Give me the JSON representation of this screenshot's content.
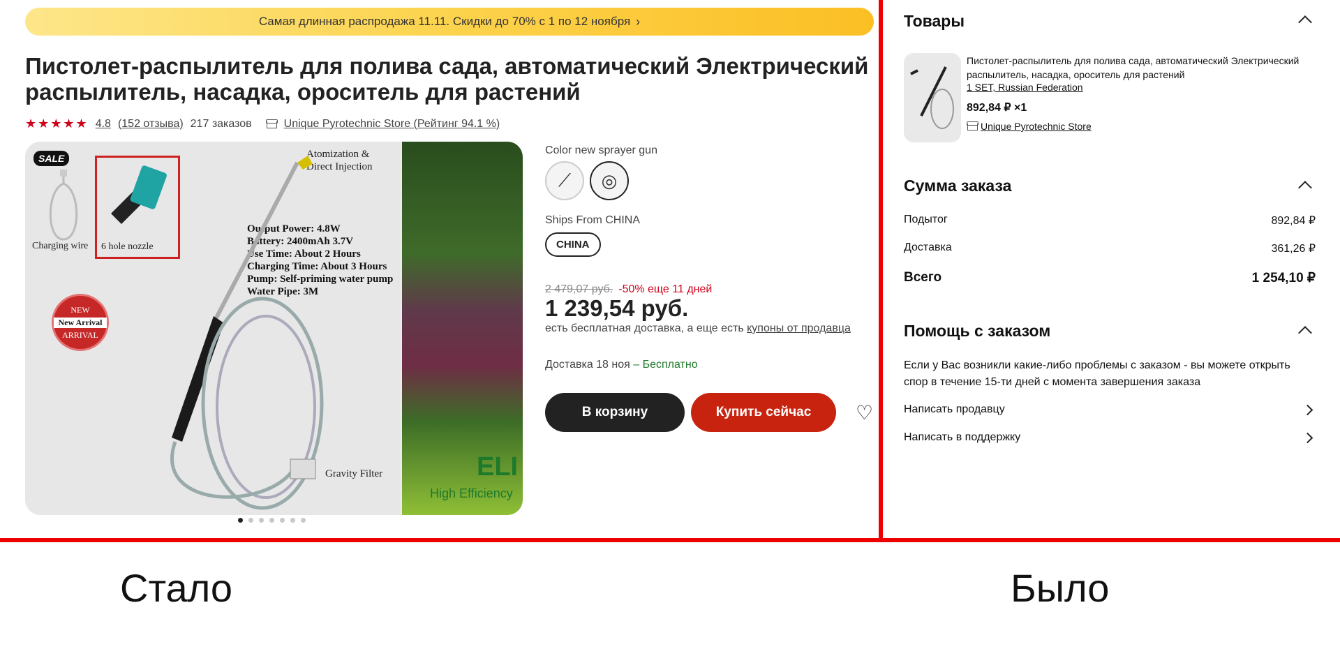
{
  "banner": {
    "text": "Самая длинная распродажа 11.11. Скидки до 70% с 1 по 12 ноября"
  },
  "product": {
    "title": "Пистолет-распылитель для полива сада, автоматический Электрический распылитель, насадка, ороситель для растений",
    "rating": "4.8",
    "reviews": "(152 отзыва)",
    "orders": "217 заказов",
    "store": "Unique Pyrotechnic Store (Рейтинг 94.1 %)"
  },
  "gallery": {
    "sale": "SALE",
    "charging_wire": "Charging wire",
    "nozzle": "6 hole nozzle",
    "atomization": "Atomization &",
    "direct_injection": "Direct Injection",
    "specs": [
      "Output Power: 4.8W",
      "Battery: 2400mAh 3.7V",
      "Use Time: About 2 Hours",
      "Charging Time: About 3 Hours",
      "Pump: Self-priming water pump",
      "Water Pipe: 3M"
    ],
    "new_top": "NEW",
    "new_mid": "New Arrival",
    "new_bottom": "ARRIVAL",
    "gravity_filter": "Gravity Filter",
    "elite": "ELI",
    "high_eff": "High Efficiency",
    "dots": 7,
    "active_dot": 0
  },
  "options": {
    "color_label": "Color new sprayer gun",
    "ships_label": "Ships From CHINA",
    "ships_value": "CHINA"
  },
  "pricing": {
    "old_price": "2 479,07 руб.",
    "discount": "-50% еще 11 дней",
    "price": "1 239,54 руб.",
    "free_note": "есть бесплатная доставка, а еще есть",
    "coupon_link": "купоны от продавца",
    "delivery": "Доставка 18 ноя",
    "delivery_free": "– Бесплатно"
  },
  "actions": {
    "cart": "В корзину",
    "buy": "Купить сейчас"
  },
  "summary": {
    "goods_header": "Товары",
    "item_title": "Пистолет-распылитель для полива сада, автоматический Электрический распылитель, насадка, ороситель для растений",
    "item_variant": "1 SET, Russian Federation",
    "item_price": "892,84 ₽ ×1",
    "item_store": "Unique Pyrotechnic Store",
    "order_header": "Сумма заказа",
    "subtotal_label": "Подытог",
    "subtotal_value": "892,84 ₽",
    "shipping_label": "Доставка",
    "shipping_value": "361,26 ₽",
    "total_label": "Всего",
    "total_value": "1 254,10 ₽",
    "help_header": "Помощь с заказом",
    "help_text": "Если у Вас возникли какие-либо проблемы с заказом - вы можете открыть спор в течение 15-ти дней с момента завершения заказа",
    "contact_seller": "Написать продавцу",
    "contact_support": "Написать в поддержку"
  },
  "captions": {
    "now": "Стало",
    "before": "Было"
  },
  "colors": {
    "accent_red": "#c8230f",
    "divider": "#ee0000",
    "banner": "#fcd34d",
    "rating": "#d0021b"
  }
}
